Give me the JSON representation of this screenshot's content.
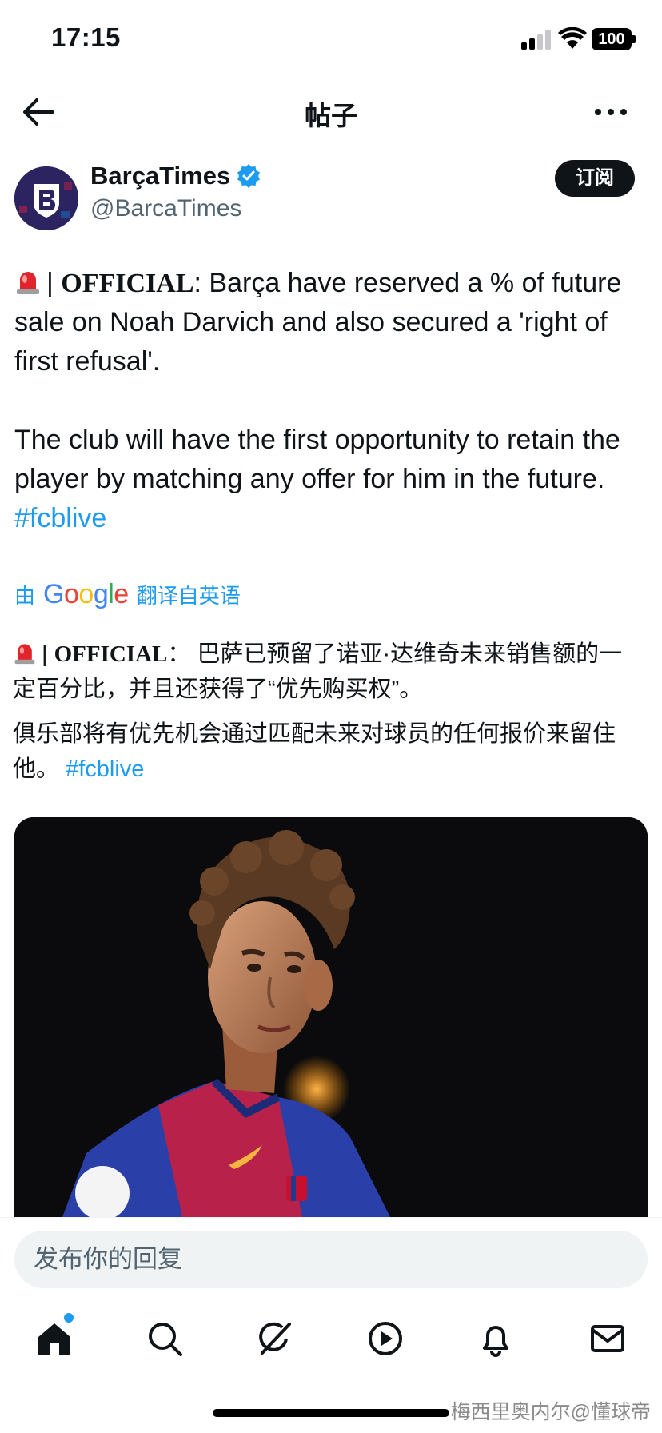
{
  "status_bar": {
    "time": "17:15",
    "battery": "100"
  },
  "nav": {
    "title": "帖子"
  },
  "author": {
    "display_name": "BarçaTimes",
    "handle": "@BarcaTimes",
    "subscribe_label": "订阅"
  },
  "tweet": {
    "official_label": "OFFICIAL",
    "para1_rest": ": Barça have reserved a % of future sale on Noah Darvich and also secured a 'right of first refusal'.",
    "para2_text": "The club will have the first opportunity to retain the player by matching any offer for him in the future. ",
    "hashtag": "#fcblive"
  },
  "translation": {
    "by_label": "由",
    "google": "Google",
    "from_label": "翻译自英语",
    "official_label": "OFFICIAL",
    "para1_rest": "： 巴萨已预留了诺亚·达维奇未来销售额的一定百分比，并且还获得了“优先购买权”。",
    "para2_text": "俱乐部将有优先机会通过匹配未来对球员的任何报价来留住他。 ",
    "hashtag": "#fcblive"
  },
  "reply": {
    "placeholder": "发布你的回复"
  },
  "tabs": [
    "home-icon",
    "search-icon",
    "grok-icon",
    "play-icon",
    "bell-icon",
    "mail-icon"
  ],
  "watermark": "梅西里奥内尔@懂球帝",
  "colors": {
    "accent": "#1d9bf0",
    "text": "#0f1419",
    "muted": "#536471"
  }
}
